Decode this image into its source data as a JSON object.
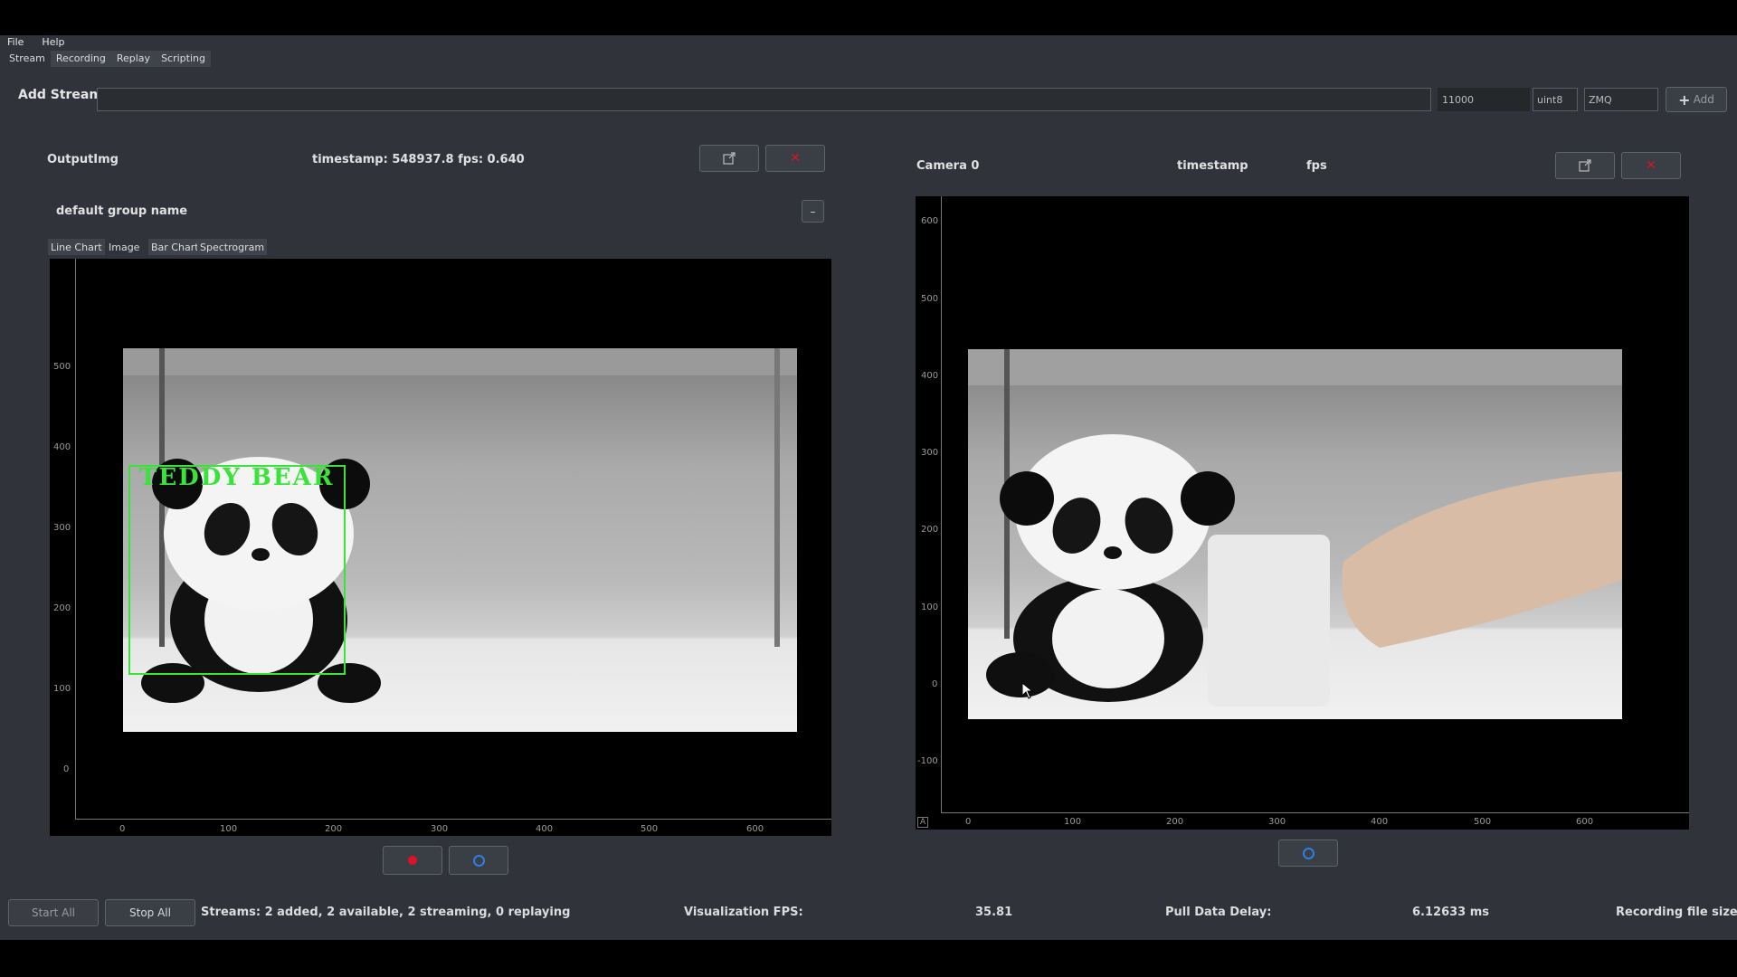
{
  "menu": [
    "File",
    "Help"
  ],
  "tabs": [
    {
      "label": "Stream",
      "active": false
    },
    {
      "label": "Recording",
      "active": true
    },
    {
      "label": "Replay",
      "active": true
    },
    {
      "label": "Scripting",
      "active": true
    }
  ],
  "add_stream": {
    "label": "Add Stream",
    "url_value": "",
    "port_value": "11000",
    "dtype_value": "uint8",
    "proto_value": "ZMQ",
    "add_label": "Add"
  },
  "left_panel": {
    "title": "OutputImg",
    "timestamp_text": "timestamp: 548937.8  fps: 0.640",
    "group_name": "default group name",
    "group_toggle": "–",
    "viz_tabs": [
      "Line Chart",
      "Image",
      "Bar Chart",
      "Spectrogram"
    ],
    "y_ticks": [
      "500",
      "400",
      "300",
      "200",
      "100",
      "0"
    ],
    "x_ticks": [
      "0",
      "100",
      "200",
      "300",
      "400",
      "500",
      "600"
    ],
    "detection_label": "TEDDY BEAR",
    "detection_color": "#39e339"
  },
  "right_panel": {
    "title": "Camera 0",
    "timestamp_label": "timestamp",
    "fps_label": "fps",
    "y_ticks": [
      "600",
      "500",
      "400",
      "300",
      "200",
      "100",
      "0",
      "-100"
    ],
    "x_ticks": [
      "0",
      "100",
      "200",
      "300",
      "400",
      "500",
      "600"
    ],
    "corner_label": "A"
  },
  "status_bar": {
    "start_all": "Start All",
    "stop_all": "Stop All",
    "streams_text": "Streams: 2 added, 2 available, 2 streaming, 0 replaying",
    "viz_fps_label": "Visualization FPS:",
    "viz_fps_value": "35.81",
    "pull_delay_label": "Pull Data Delay:",
    "pull_delay_value": "6.12633 ms",
    "recording_label": "Recording file size:"
  },
  "colors": {
    "record": "#e0102a",
    "refresh": "#2f7fe0",
    "panel_bg": "#30343a"
  }
}
